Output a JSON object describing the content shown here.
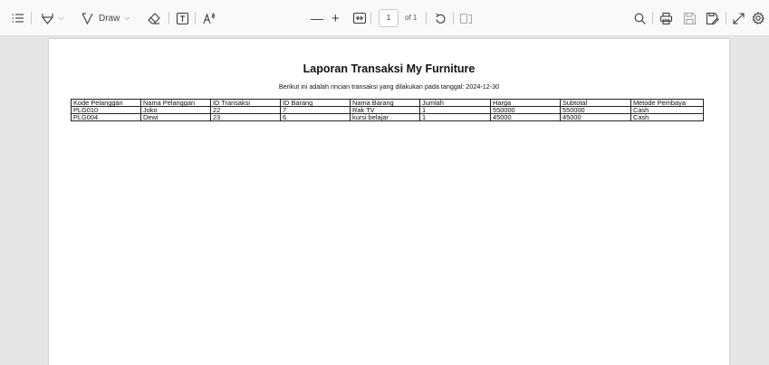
{
  "toolbar": {
    "draw_label": "Draw",
    "zoom_out": "—",
    "zoom_in": "+",
    "page_current": "1",
    "page_total": "of 1"
  },
  "document": {
    "title": "Laporan Transaksi My Furniture",
    "subtitle": "Berikut ini adalah rincian transaksi yang dilakukan pada tanggal: 2024-12-30",
    "columns": [
      "Kode Pelanggan",
      "Nama Pelanggan",
      "ID Transaksi",
      "ID Barang",
      "Nama Barang",
      "Jumlah",
      "Harga",
      "Subtotal",
      "Metode Pembaya"
    ],
    "rows": [
      [
        "PLG010",
        "Joko",
        "22",
        "7",
        "Rak TV",
        "1",
        "550000",
        "550000",
        "Cash"
      ],
      [
        "PLG004",
        "Dewi",
        "23",
        "6",
        "kursi belajar",
        "1",
        "45000",
        "45000",
        "Cash"
      ]
    ]
  }
}
